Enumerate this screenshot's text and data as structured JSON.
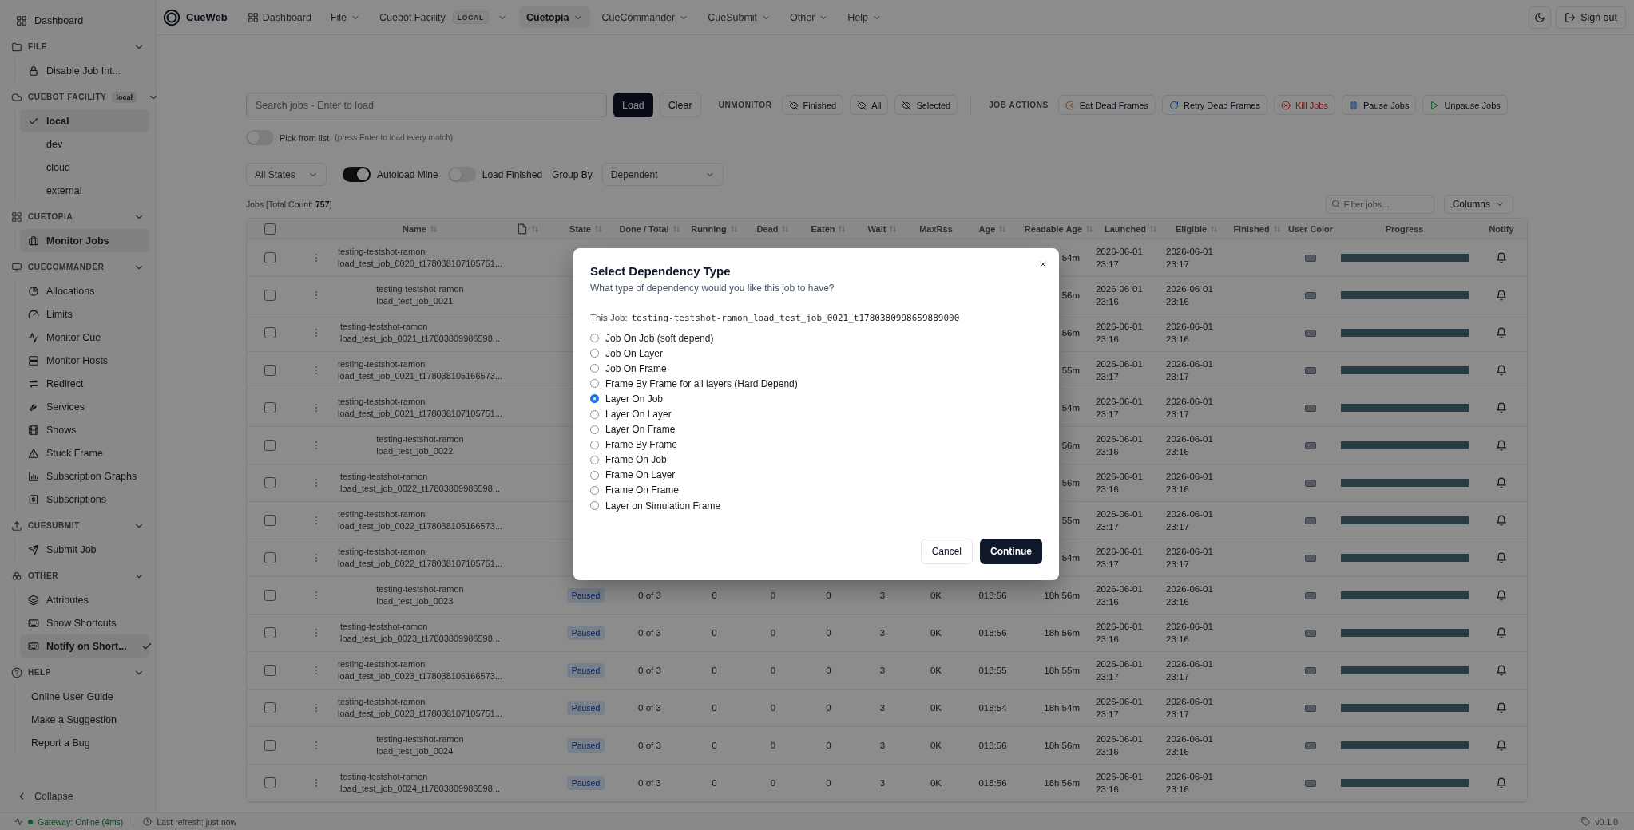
{
  "nav": {
    "brand": "CueWeb",
    "items": [
      {
        "label": "Dashboard",
        "kind": "link",
        "selected": false
      },
      {
        "label": "File",
        "kind": "menu",
        "selected": false
      },
      {
        "label": "Cuebot Facility",
        "badge": "LOCAL",
        "kind": "menu",
        "selected": false
      },
      {
        "label": "Cuetopia",
        "kind": "menu",
        "selected": true
      },
      {
        "label": "CueCommander",
        "kind": "menu",
        "selected": false
      },
      {
        "label": "CueSubmit",
        "kind": "menu",
        "selected": false
      },
      {
        "label": "Other",
        "kind": "menu",
        "selected": false
      },
      {
        "label": "Help",
        "kind": "menu",
        "selected": false
      }
    ],
    "sign_out": "Sign out"
  },
  "sidebar": {
    "top": {
      "label": "Dashboard",
      "selected": false
    },
    "sections": [
      {
        "title": "FILE",
        "expanded": true,
        "items": [
          {
            "label": "Disable Job Int...",
            "kind": "link",
            "selected": false
          }
        ]
      },
      {
        "title": "CUEBOT FACILITY",
        "badge": "local",
        "expanded": true,
        "items": [
          {
            "label": "local",
            "kind": "option",
            "selected": true,
            "checked": true
          },
          {
            "label": "dev",
            "kind": "option",
            "selected": false,
            "checked": false
          },
          {
            "label": "cloud",
            "kind": "option",
            "selected": false,
            "checked": false
          },
          {
            "label": "external",
            "kind": "option",
            "selected": false,
            "checked": false
          }
        ]
      },
      {
        "title": "CUETOPIA",
        "expanded": true,
        "items": [
          {
            "label": "Monitor Jobs",
            "kind": "link",
            "selected": true
          }
        ]
      },
      {
        "title": "CUECOMMANDER",
        "expanded": true,
        "items": [
          {
            "label": "Allocations",
            "kind": "link",
            "selected": false
          },
          {
            "label": "Limits",
            "kind": "link",
            "selected": false
          },
          {
            "label": "Monitor Cue",
            "kind": "link",
            "selected": false
          },
          {
            "label": "Monitor Hosts",
            "kind": "link",
            "selected": false
          },
          {
            "label": "Redirect",
            "kind": "link",
            "selected": false
          },
          {
            "label": "Services",
            "kind": "link",
            "selected": false
          },
          {
            "label": "Shows",
            "kind": "link",
            "selected": false
          },
          {
            "label": "Stuck Frame",
            "kind": "link",
            "selected": false
          },
          {
            "label": "Subscription Graphs",
            "kind": "link",
            "selected": false
          },
          {
            "label": "Subscriptions",
            "kind": "link",
            "selected": false
          }
        ]
      },
      {
        "title": "CUESUBMIT",
        "expanded": true,
        "items": [
          {
            "label": "Submit Job",
            "kind": "link",
            "selected": false
          }
        ]
      },
      {
        "title": "OTHER",
        "expanded": true,
        "items": [
          {
            "label": "Attributes",
            "kind": "link",
            "selected": false
          },
          {
            "label": "Show Shortcuts",
            "kind": "link",
            "selected": false
          },
          {
            "label": "Notify on Short...",
            "kind": "toggle",
            "selected": true,
            "checked": true
          }
        ]
      },
      {
        "title": "HELP",
        "expanded": true,
        "items": [
          {
            "label": "Online User Guide",
            "kind": "plain",
            "selected": false
          },
          {
            "label": "Make a Suggestion",
            "kind": "plain",
            "selected": false
          },
          {
            "label": "Report a Bug",
            "kind": "plain",
            "selected": false
          }
        ]
      }
    ],
    "collapse": "Collapse"
  },
  "search": {
    "placeholder": "Search jobs - Enter to load",
    "load": "Load",
    "clear": "Clear"
  },
  "unmonitor": {
    "title": "UNMONITOR",
    "buttons": [
      "Finished",
      "All",
      "Selected"
    ]
  },
  "job_actions": {
    "title": "JOB ACTIONS",
    "buttons": [
      {
        "label": "Eat Dead Frames",
        "danger": false
      },
      {
        "label": "Retry Dead Frames",
        "danger": false
      },
      {
        "label": "Kill Jobs",
        "danger": true
      },
      {
        "label": "Pause Jobs",
        "danger": false
      },
      {
        "label": "Unpause Jobs",
        "danger": false
      }
    ]
  },
  "pick_from_list": {
    "label": "Pick from list",
    "hint": "(press Enter to load every match)",
    "on": false
  },
  "filters": {
    "state": "All States",
    "autoload": {
      "label": "Autoload Mine",
      "on": true
    },
    "load_finished": {
      "label": "Load Finished",
      "on": false
    },
    "group_by_label": "Group By",
    "group_by": "Dependent"
  },
  "jobs_count": "Jobs [Total Count: **757**]",
  "filter": {
    "placeholder": "Filter jobs..."
  },
  "columns_button": "Columns",
  "table": {
    "select_all": false,
    "columns": [
      {
        "kind": "text",
        "label": "Name",
        "sortable": true
      },
      {
        "kind": "file_icon",
        "sortable": true
      },
      {
        "kind": "text",
        "label": "State",
        "sortable": true
      },
      {
        "kind": "text",
        "label": "Done / Total",
        "sortable": true
      },
      {
        "kind": "text",
        "label": "Running",
        "sortable": true
      },
      {
        "kind": "text",
        "label": "Dead",
        "sortable": true
      },
      {
        "kind": "text",
        "label": "Eaten",
        "sortable": true
      },
      {
        "kind": "text",
        "label": "Wait",
        "sortable": true
      },
      {
        "kind": "text",
        "label": "MaxRss",
        "sortable": false
      },
      {
        "kind": "text",
        "label": "Age",
        "sortable": true
      },
      {
        "kind": "text",
        "label": "Readable Age",
        "sortable": true
      },
      {
        "kind": "text",
        "label": "Launched",
        "sortable": true
      },
      {
        "kind": "text",
        "label": "Eligible",
        "sortable": true
      },
      {
        "kind": "text",
        "label": "Finished",
        "sortable": true
      },
      {
        "kind": "text",
        "label": "User Color",
        "sortable": false
      },
      {
        "kind": "text",
        "label": "Progress",
        "sortable": false
      },
      {
        "kind": "text",
        "label": "Notify",
        "sortable": false
      }
    ],
    "rows": [
      {
        "checked": false,
        "name": [
          "testing-testshot-ramon",
          "load_test_job_0020_t178038107105751..."
        ],
        "readable_age": "54m",
        "launched": "2026-06-01 23:17",
        "eligible": "2026-06-01 23:17",
        "level": 1
      },
      {
        "checked": false,
        "name": [
          "testing-testshot-ramon",
          "load_test_job_0021"
        ],
        "readable_age": "56m",
        "launched": "2026-06-01 23:16",
        "eligible": "2026-06-01 23:16",
        "level": 1
      },
      {
        "checked": false,
        "name": [
          "testing-testshot-ramon",
          "load_test_job_0021_t17803809986598..."
        ],
        "readable_age": "56m",
        "launched": "2026-06-01 23:16",
        "eligible": "2026-06-01 23:16",
        "level": 1
      },
      {
        "checked": false,
        "name": [
          "testing-testshot-ramon",
          "load_test_job_0021_t178038105166573..."
        ],
        "readable_age": "55m",
        "launched": "2026-06-01 23:17",
        "eligible": "2026-06-01 23:17",
        "level": 1
      },
      {
        "checked": false,
        "name": [
          "testing-testshot-ramon",
          "load_test_job_0021_t178038107105751..."
        ],
        "readable_age": "54m",
        "launched": "2026-06-01 23:17",
        "eligible": "2026-06-01 23:17",
        "level": 1
      },
      {
        "checked": false,
        "name": [
          "testing-testshot-ramon",
          "load_test_job_0022"
        ],
        "readable_age": "56m",
        "launched": "2026-06-01 23:16",
        "eligible": "2026-06-01 23:16",
        "level": 1
      },
      {
        "checked": false,
        "name": [
          "testing-testshot-ramon",
          "load_test_job_0022_t17803809986598..."
        ],
        "readable_age": "56m",
        "launched": "2026-06-01 23:16",
        "eligible": "2026-06-01 23:16",
        "level": 1
      },
      {
        "checked": false,
        "name": [
          "testing-testshot-ramon",
          "load_test_job_0022_t178038105166573..."
        ],
        "readable_age": "55m",
        "launched": "2026-06-01 23:17",
        "eligible": "2026-06-01 23:17",
        "level": 1
      },
      {
        "checked": false,
        "name": [
          "testing-testshot-ramon",
          "load_test_job_0022_t178038107105751..."
        ],
        "readable_age": "54m",
        "launched": "2026-06-01 23:17",
        "eligible": "2026-06-01 23:17",
        "level": 1
      },
      {
        "checked": false,
        "name": [
          "testing-testshot-ramon",
          "load_test_job_0023"
        ],
        "state": "Paused",
        "done_total": "0 of 3",
        "running": "0",
        "dead": "0",
        "eaten": "0",
        "wait": "3",
        "maxrss": "0K",
        "age": "018:56",
        "readable_age": "18h 56m",
        "launched": "2026-06-01 23:16",
        "eligible": "2026-06-01 23:16",
        "level": 1
      },
      {
        "checked": false,
        "name": [
          "testing-testshot-ramon",
          "load_test_job_0023_t17803809986598..."
        ],
        "state": "Paused",
        "done_total": "0 of 3",
        "running": "0",
        "dead": "0",
        "eaten": "0",
        "wait": "3",
        "maxrss": "0K",
        "age": "018:56",
        "readable_age": "18h 56m",
        "launched": "2026-06-01 23:16",
        "eligible": "2026-06-01 23:16",
        "level": 1
      },
      {
        "checked": false,
        "name": [
          "testing-testshot-ramon",
          "load_test_job_0023_t178038105166573..."
        ],
        "state": "Paused",
        "done_total": "0 of 3",
        "running": "0",
        "dead": "0",
        "eaten": "0",
        "wait": "3",
        "maxrss": "0K",
        "age": "018:55",
        "readable_age": "18h 55m",
        "launched": "2026-06-01 23:17",
        "eligible": "2026-06-01 23:17",
        "level": 1
      },
      {
        "checked": false,
        "name": [
          "testing-testshot-ramon",
          "load_test_job_0023_t178038107105751..."
        ],
        "state": "Paused",
        "done_total": "0 of 3",
        "running": "0",
        "dead": "0",
        "eaten": "0",
        "wait": "3",
        "maxrss": "0K",
        "age": "018:54",
        "readable_age": "18h 54m",
        "launched": "2026-06-01 23:17",
        "eligible": "2026-06-01 23:17",
        "level": 1
      },
      {
        "checked": false,
        "name": [
          "testing-testshot-ramon",
          "load_test_job_0024"
        ],
        "state": "Paused",
        "done_total": "0 of 3",
        "running": "0",
        "dead": "0",
        "eaten": "0",
        "wait": "3",
        "maxrss": "0K",
        "age": "018:56",
        "readable_age": "18h 56m",
        "launched": "2026-06-01 23:16",
        "eligible": "2026-06-01 23:16",
        "level": 1
      },
      {
        "checked": false,
        "name": [
          "testing-testshot-ramon",
          "load_test_job_0024_t17803809986598..."
        ],
        "state": "Paused",
        "done_total": "0 of 3",
        "running": "0",
        "dead": "0",
        "eaten": "0",
        "wait": "3",
        "maxrss": "0K",
        "age": "018:56",
        "readable_age": "18h 56m",
        "launched": "2026-06-01 23:16",
        "eligible": "2026-06-01 23:16",
        "level": 1
      }
    ]
  },
  "modal": {
    "title": "Select Dependency Type",
    "subtitle": "What type of dependency would you like this job to have?",
    "job_label": "This Job:",
    "job_name": "testing-testshot-ramon_load_test_job_0021_t1780380998659889000",
    "options": [
      {
        "label": "Job On Job (soft depend)",
        "selected": false
      },
      {
        "label": "Job On Layer",
        "selected": false
      },
      {
        "label": "Job On Frame",
        "selected": false
      },
      {
        "label": "Frame By Frame for all layers (Hard Depend)",
        "selected": false
      },
      {
        "label": "Layer On Job",
        "selected": true
      },
      {
        "label": "Layer On Layer",
        "selected": false
      },
      {
        "label": "Layer On Frame",
        "selected": false
      },
      {
        "label": "Frame By Frame",
        "selected": false
      },
      {
        "label": "Frame On Job",
        "selected": false
      },
      {
        "label": "Frame On Layer",
        "selected": false
      },
      {
        "label": "Frame On Frame",
        "selected": false
      },
      {
        "label": "Layer on Simulation Frame",
        "selected": false
      }
    ],
    "cancel": "Cancel",
    "continue": "Continue"
  },
  "status_bar": {
    "gateway": "Gateway: Online (4ms)",
    "online": true,
    "refresh": "Last refresh: just now",
    "version": "v0.1.0"
  }
}
